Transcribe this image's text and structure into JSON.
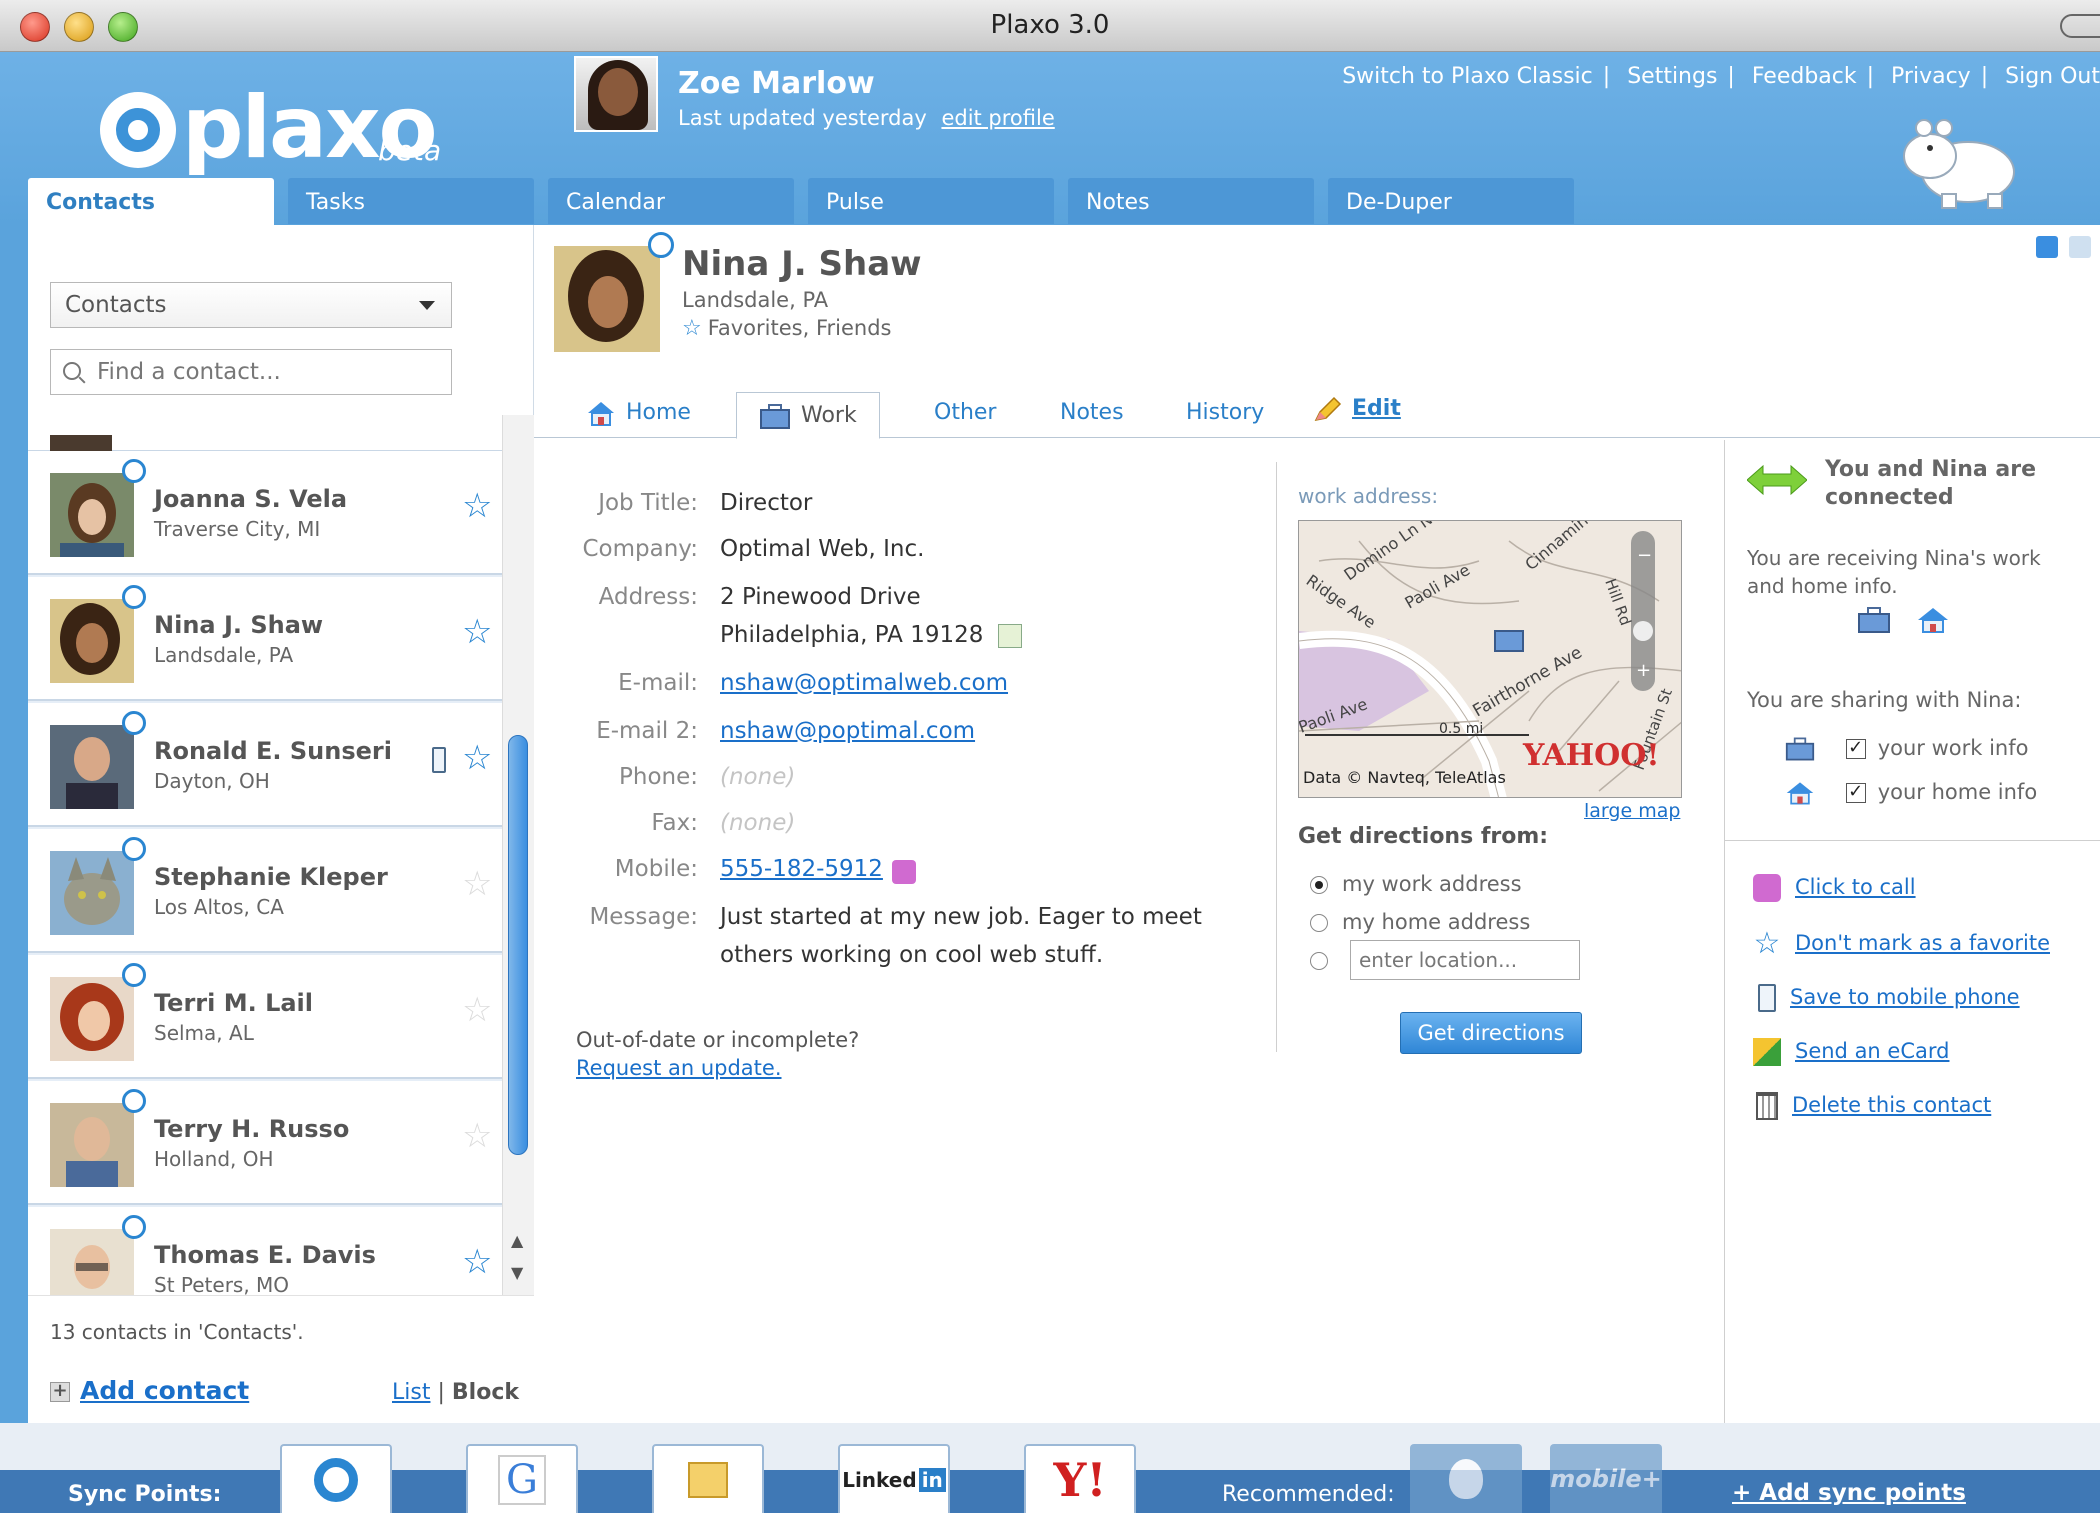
{
  "window": {
    "title": "Plaxo 3.0"
  },
  "header": {
    "logo_text": "plaxo",
    "logo_beta": "beta",
    "user_name": "Zoe Marlow",
    "last_updated": "Last updated yesterday",
    "edit_profile": "edit profile",
    "links": [
      "Switch to Plaxo Classic",
      "Settings",
      "Feedback",
      "Privacy",
      "Sign Out"
    ]
  },
  "tabs": [
    "Contacts",
    "Tasks",
    "Calendar",
    "Pulse",
    "Notes",
    "De-Duper"
  ],
  "sidebar": {
    "dropdown_value": "Contacts",
    "search_placeholder": "Find a contact...",
    "contacts": [
      {
        "name": "Joanna S. Vela",
        "location": "Traverse City, MI",
        "favorite": true
      },
      {
        "name": "Nina J. Shaw",
        "location": "Landsdale, PA",
        "favorite": true
      },
      {
        "name": "Ronald E. Sunseri",
        "location": "Dayton, OH",
        "favorite": true
      },
      {
        "name": "Stephanie Kleper",
        "location": "Los Altos, CA",
        "favorite": false
      },
      {
        "name": "Terri M. Lail",
        "location": "Selma, AL",
        "favorite": false
      },
      {
        "name": "Terry H. Russo",
        "location": "Holland, OH",
        "favorite": false
      },
      {
        "name": "Thomas E. Davis",
        "location": "St Peters, MO",
        "favorite": true
      }
    ],
    "count_text": "13 contacts in 'Contacts'.",
    "add_contact": "Add contact",
    "view_list": "List",
    "view_sep": "|",
    "view_block": "Block"
  },
  "detail": {
    "name": "Nina J. Shaw",
    "location": "Landsdale, PA",
    "groups": "Favorites, Friends",
    "subtabs": [
      "Home",
      "Work",
      "Other",
      "Notes",
      "History",
      "Edit"
    ],
    "fields": {
      "job_title_label": "Job Title:",
      "job_title": "Director",
      "company_label": "Company:",
      "company": "Optimal Web, Inc.",
      "address_label": "Address:",
      "address_line1": "2 Pinewood Drive",
      "address_line2": "Philadelphia, PA 19128",
      "email_label": "E-mail:",
      "email": "nshaw@optimalweb.com",
      "email2_label": "E-mail 2:",
      "email2": "nshaw@poptimal.com",
      "phone_label": "Phone:",
      "phone": "(none)",
      "fax_label": "Fax:",
      "fax": "(none)",
      "mobile_label": "Mobile:",
      "mobile": "555-182-5912",
      "message_label": "Message:",
      "message_line1": "Just started at my new job. Eager to meet",
      "message_line2": "others working on cool web stuff."
    },
    "out_of_date": "Out-of-date or incomplete?",
    "request_update": "Request an update.",
    "map": {
      "label": "work address:",
      "large_map": "large map",
      "streets": [
        "Domino Ln N",
        "Ridge Ave",
        "Paoli Ave",
        "Cinnamin St",
        "Hill Rd",
        "Fairthorne Ave",
        "Paoli Ave",
        "Fountain St"
      ],
      "scale": "0.5 mi",
      "credit": "Data © Navteq, TeleAtlas",
      "brand": "YAHOO!"
    },
    "directions": {
      "title": "Get directions from:",
      "opt_work": "my work address",
      "opt_home": "my home address",
      "location_placeholder": "enter location...",
      "button": "Get directions"
    }
  },
  "connection": {
    "status": "You and Nina are connected",
    "receiving": "You are receiving Nina's work and home info.",
    "sharing": "You are sharing with Nina:",
    "share_work": "your work info",
    "share_home": "your home info",
    "actions": [
      "Click to call",
      "Don't mark as a favorite",
      "Save to mobile phone",
      "Send an eCard",
      "Delete this contact"
    ]
  },
  "sync": {
    "label": "Sync Points:",
    "linkedin_text": "Linked",
    "linkedin_in": "in",
    "yahoo_text": "Y!",
    "recommended": "Recommended:",
    "mobile_text": "mobile+",
    "add": "+ Add sync points"
  },
  "colors": {
    "header_blue": "#5aa3dc",
    "link_blue": "#1a6fc9",
    "star_blue": "#2a86d1"
  }
}
